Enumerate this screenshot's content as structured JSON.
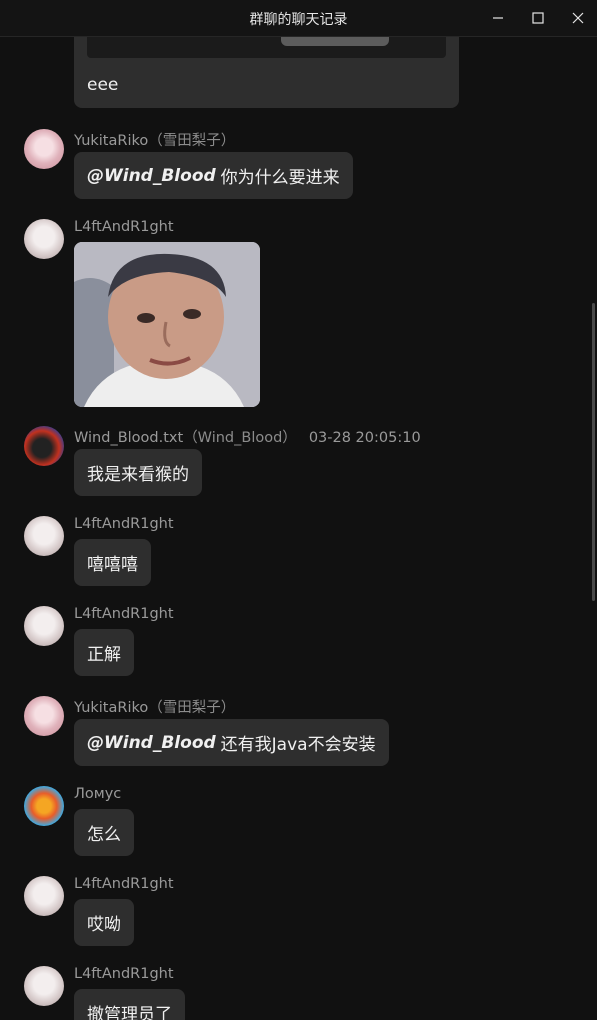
{
  "window": {
    "title": "群聊的聊天记录",
    "controls": [
      "minimize-icon",
      "maximize-icon",
      "close-icon"
    ]
  },
  "top_partial": {
    "text": "eee"
  },
  "messages": [
    {
      "sender": "YukitaRiko",
      "alias": "（雪田梨子）",
      "mention": "@Wind_Blood",
      "text": "你为什么要进来",
      "avatar": "avatar-yukitariko"
    },
    {
      "sender": "L4ftAndR1ght",
      "alias": "",
      "type": "image",
      "avatar": "avatar-l4ftandr1ght"
    },
    {
      "sender": "Wind_Blood.txt",
      "alias": "（Wind_Blood）",
      "time": "03-28 20:05:10",
      "text": "我是来看猴的",
      "avatar": "avatar-wind-blood"
    },
    {
      "sender": "L4ftAndR1ght",
      "alias": "",
      "text": "嘻嘻嘻",
      "avatar": "avatar-l4ftandr1ght"
    },
    {
      "sender": "L4ftAndR1ght",
      "alias": "",
      "text": "正解",
      "avatar": "avatar-l4ftandr1ght"
    },
    {
      "sender": "YukitaRiko",
      "alias": "（雪田梨子）",
      "mention": "@Wind_Blood",
      "text": "还有我Java不会安装",
      "avatar": "avatar-yukitariko"
    },
    {
      "sender": "Ломус",
      "alias": "",
      "text": "怎么",
      "avatar": "avatar-lomus"
    },
    {
      "sender": "L4ftAndR1ght",
      "alias": "",
      "text": "哎呦",
      "avatar": "avatar-l4ftandr1ght"
    },
    {
      "sender": "L4ftAndR1ght",
      "alias": "",
      "text": "撤管理员了",
      "avatar": "avatar-l4ftandr1ght"
    }
  ],
  "colors": {
    "background": "#111111",
    "bubble": "#2e2e2e",
    "name": "#9a9a9a",
    "text": "#f0f0f0"
  }
}
